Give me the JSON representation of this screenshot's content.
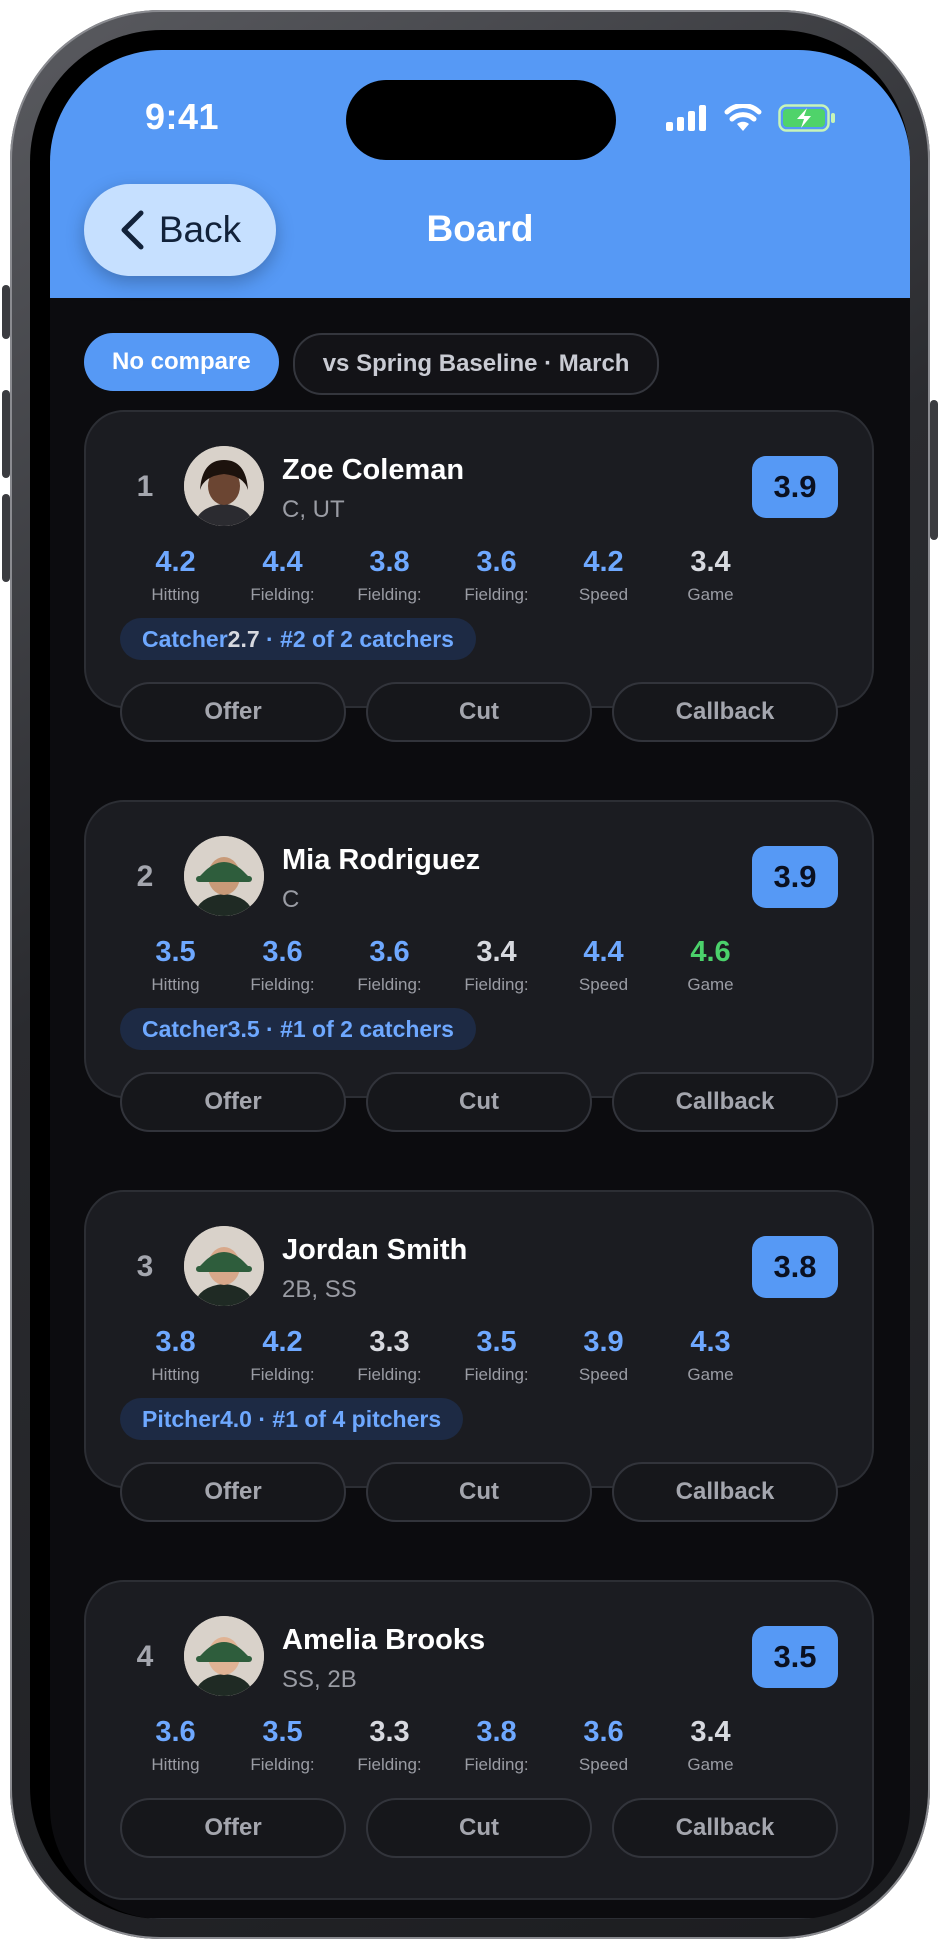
{
  "status_bar": {
    "time": "9:41"
  },
  "nav": {
    "back_label": "Back",
    "title": "Board"
  },
  "compare": {
    "active": "No compare",
    "option": "vs Spring Baseline · March"
  },
  "colors": {
    "accent": "#5699f5",
    "up": "#6ea8ff",
    "neutral": "#d7d9df",
    "green": "#4bd16b"
  },
  "stat_labels": [
    "Hitting",
    "Fielding:",
    "Fielding:",
    "Fielding:",
    "Speed",
    "Game"
  ],
  "actions": {
    "offer": "Offer",
    "cut": "Cut",
    "callback": "Callback"
  },
  "players": [
    {
      "rank": "1",
      "name": "Zoe Coleman",
      "positions": "C, UT",
      "score": "3.9",
      "stats": [
        {
          "value": "4.2",
          "tone": "up"
        },
        {
          "value": "4.4",
          "tone": "up"
        },
        {
          "value": "3.8",
          "tone": "up"
        },
        {
          "value": "3.6",
          "tone": "up"
        },
        {
          "value": "4.2",
          "tone": "up"
        },
        {
          "value": "3.4",
          "tone": "neutral"
        }
      ],
      "tag": {
        "role": "Catcher",
        "value": "2.7",
        "rank_text": " · #2 of 2 catchers"
      }
    },
    {
      "rank": "2",
      "name": "Mia Rodriguez",
      "positions": "C",
      "score": "3.9",
      "stats": [
        {
          "value": "3.5",
          "tone": "up"
        },
        {
          "value": "3.6",
          "tone": "up"
        },
        {
          "value": "3.6",
          "tone": "up"
        },
        {
          "value": "3.4",
          "tone": "neutral"
        },
        {
          "value": "4.4",
          "tone": "up"
        },
        {
          "value": "4.6",
          "tone": "green"
        }
      ],
      "tag": {
        "role": "Catcher",
        "value": "3.5",
        "rank_text": " · #1 of 2 catchers"
      }
    },
    {
      "rank": "3",
      "name": "Jordan Smith",
      "positions": "2B, SS",
      "score": "3.8",
      "stats": [
        {
          "value": "3.8",
          "tone": "up"
        },
        {
          "value": "4.2",
          "tone": "up"
        },
        {
          "value": "3.3",
          "tone": "neutral"
        },
        {
          "value": "3.5",
          "tone": "up"
        },
        {
          "value": "3.9",
          "tone": "up"
        },
        {
          "value": "4.3",
          "tone": "up"
        }
      ],
      "tag": {
        "role": "Pitcher",
        "value": "4.0",
        "rank_text": " · #1 of 4 pitchers"
      }
    },
    {
      "rank": "4",
      "name": "Amelia Brooks",
      "positions": "SS, 2B",
      "score": "3.5",
      "stats": [
        {
          "value": "3.6",
          "tone": "up"
        },
        {
          "value": "3.5",
          "tone": "up"
        },
        {
          "value": "3.3",
          "tone": "neutral"
        },
        {
          "value": "3.8",
          "tone": "up"
        },
        {
          "value": "3.6",
          "tone": "up"
        },
        {
          "value": "3.4",
          "tone": "neutral"
        }
      ]
    }
  ]
}
